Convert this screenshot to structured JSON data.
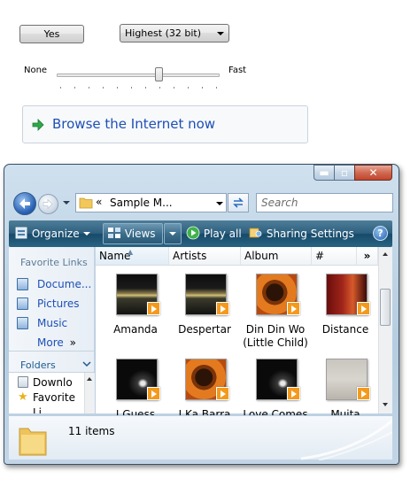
{
  "controls": {
    "yes_button": "Yes",
    "quality_select": "Highest (32 bit)",
    "slider": {
      "min_label": "None",
      "max_label": "Fast",
      "value_fraction": 0.63
    },
    "command_link": "Browse the Internet now"
  },
  "explorer": {
    "address_text": "Sample M...",
    "address_chevrons": "«",
    "search_placeholder": "Search",
    "toolbar": {
      "organize": "Organize",
      "views": "Views",
      "play_all": "Play all",
      "sharing": "Sharing Settings"
    },
    "nav": {
      "favorite_links_header": "Favorite Links",
      "links": [
        "Docume...",
        "Pictures",
        "Music"
      ],
      "more": "More",
      "more_glyph": "»",
      "folders_header": "Folders",
      "folders": [
        "Downlo",
        "Favorite",
        "Li..."
      ]
    },
    "columns": [
      "Name",
      "Artists",
      "Album",
      "#"
    ],
    "columns_more": "»",
    "items": [
      {
        "name": "Amanda",
        "art": "dark-landscape"
      },
      {
        "name": "Despertar",
        "art": "dark-landscape"
      },
      {
        "name": "Din Din Wo (Little Child)",
        "art": "orange-portrait"
      },
      {
        "name": "Distance",
        "art": "red-portrait"
      },
      {
        "name": "I Guess",
        "art": "black-swoosh"
      },
      {
        "name": "I Ka Barra",
        "art": "orange-portrait"
      },
      {
        "name": "Love Comes",
        "art": "black-swoosh"
      },
      {
        "name": "Muita",
        "art": "grey-portrait"
      }
    ],
    "status": "11 items"
  },
  "colors": {
    "link_blue": "#1e4fb5",
    "toolbar_dark": "#174a69",
    "play_badge": "#f39a1d",
    "close_red": "#c2462c"
  }
}
